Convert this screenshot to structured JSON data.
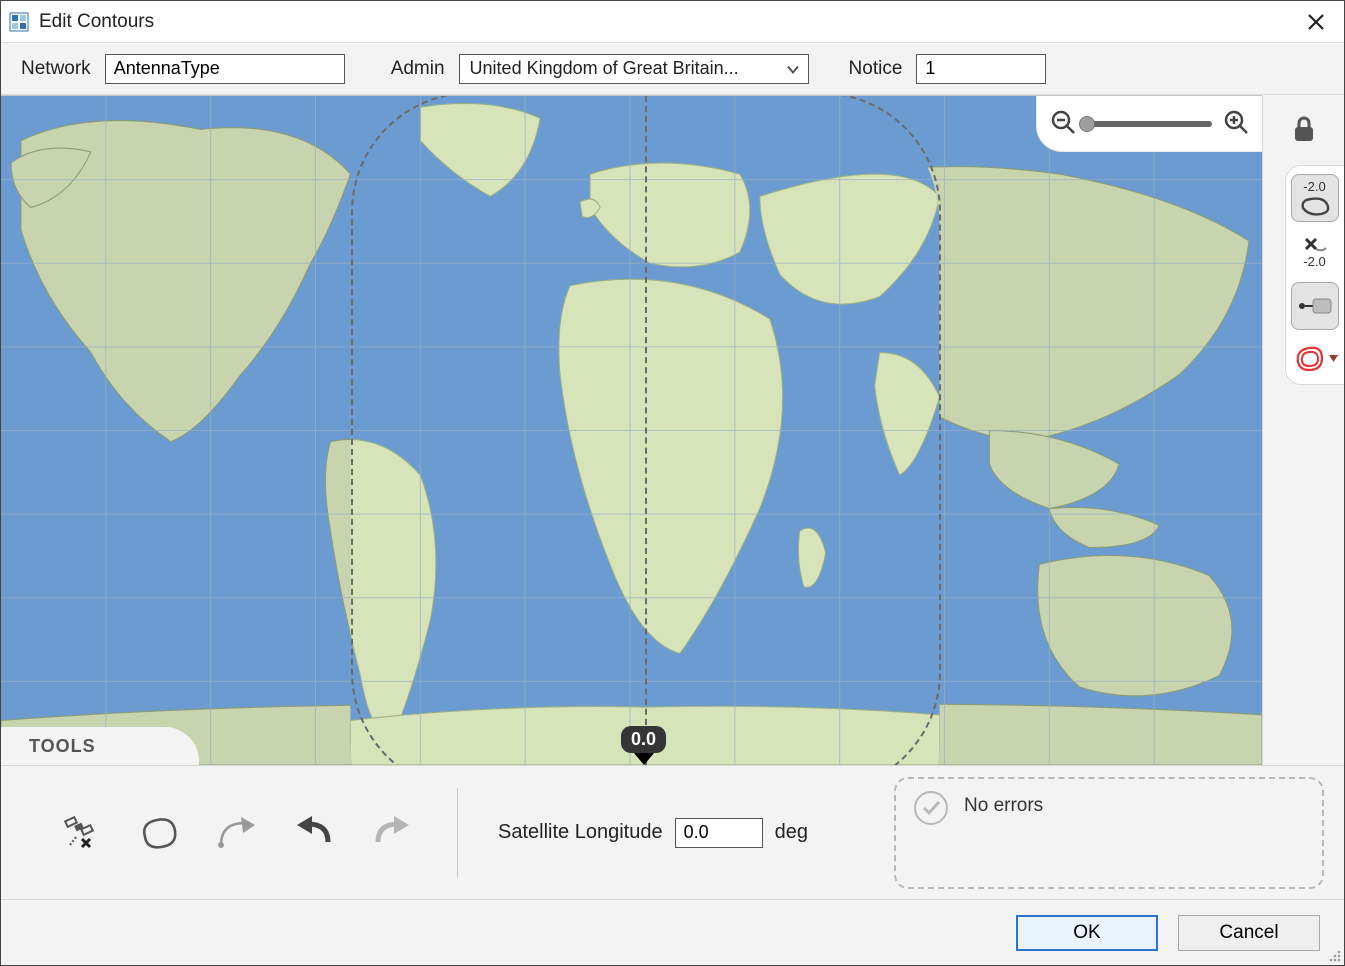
{
  "window": {
    "title": "Edit Contours"
  },
  "params": {
    "network_label": "Network",
    "network_value": "AntennaType",
    "admin_label": "Admin",
    "admin_value": "United Kingdom of Great Britain...",
    "notice_label": "Notice",
    "notice_value": "1"
  },
  "map": {
    "longitude_badge": "0.0"
  },
  "side_tools": {
    "contour_level_label": "-2.0",
    "delete_level_label": "-2.0"
  },
  "tools": {
    "panel_title": "TOOLS",
    "satellite_longitude_label": "Satellite Longitude",
    "satellite_longitude_value": "0.0",
    "satellite_longitude_unit": "deg"
  },
  "validation": {
    "message": "No errors"
  },
  "buttons": {
    "ok": "OK",
    "cancel": "Cancel"
  },
  "icons": {
    "zoom_out": "zoom-out-icon",
    "zoom_in": "zoom-in-icon",
    "lock": "lock-icon",
    "close": "close-icon"
  }
}
